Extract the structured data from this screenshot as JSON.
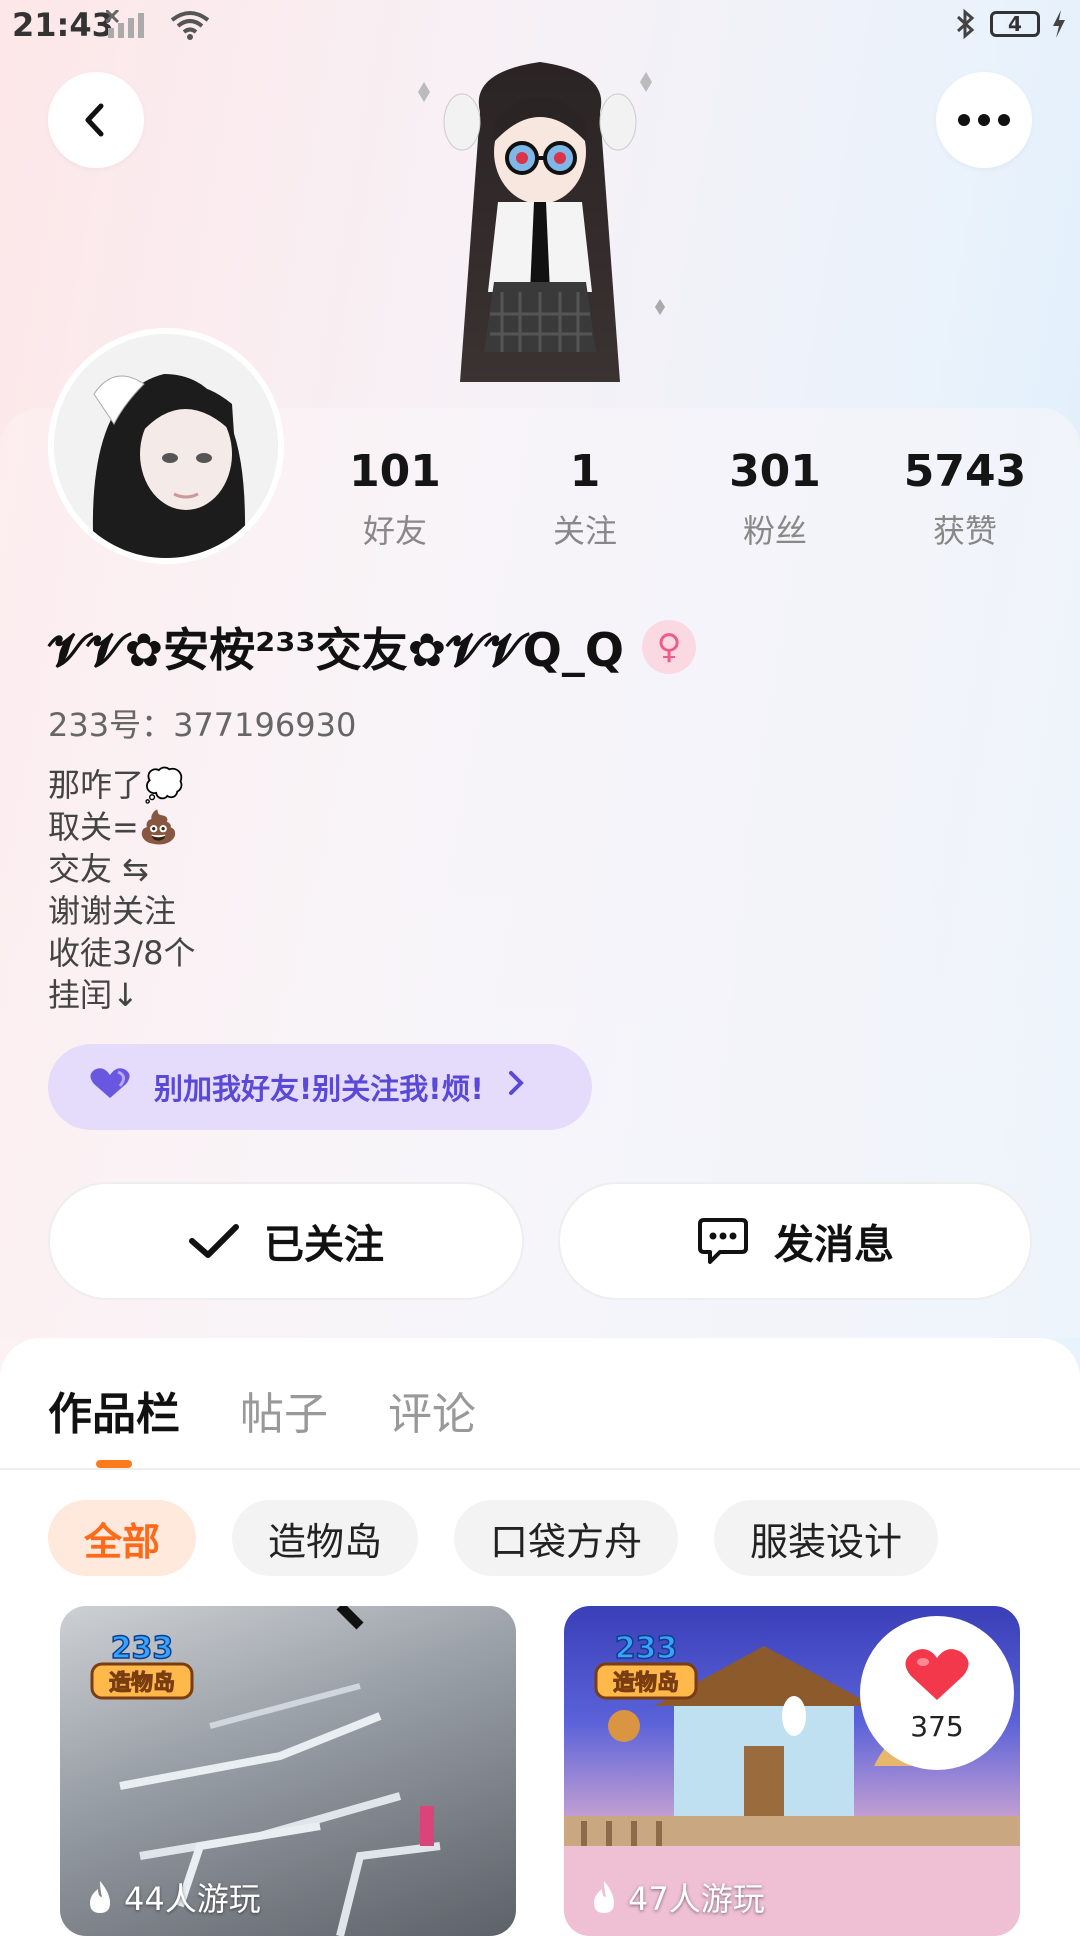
{
  "status_bar": {
    "time": "21:43",
    "battery": "4",
    "icons": [
      "sim-off-icon",
      "signal-icon",
      "wifi-icon",
      "bluetooth-icon",
      "battery-icon",
      "charging-icon"
    ]
  },
  "header": {
    "back_icon": "chevron-left-icon",
    "more_icon": "more-dots-icon"
  },
  "profile": {
    "nickname": "𝓥𝓥✿安桉²³³交友✿𝓥𝓥Q_Q",
    "gender_symbol": "♀",
    "uid": "233号：377196930",
    "bio": [
      "那咋了💭",
      "取关=💩",
      "交友 ⇆",
      "谢谢关注",
      "收徒3/8个",
      "挂闰↓"
    ],
    "notice": "别加我好友!别关注我!烦!"
  },
  "stats": [
    {
      "value": "101",
      "label": "好友"
    },
    {
      "value": "1",
      "label": "关注"
    },
    {
      "value": "301",
      "label": "粉丝"
    },
    {
      "value": "5743",
      "label": "获赞"
    }
  ],
  "actions": {
    "followed_label": "已关注",
    "message_label": "发消息"
  },
  "tabs": [
    "作品栏",
    "帖子",
    "评论"
  ],
  "active_tab": 0,
  "chips": [
    "全部",
    "造物岛",
    "口袋方舟",
    "服装设计"
  ],
  "works": [
    {
      "logo_text": "233",
      "logo_sub": "造物岛",
      "plays": "44人游玩"
    },
    {
      "logo_text": "233",
      "logo_sub": "造物岛",
      "plays": "47人游玩",
      "likes": "375"
    }
  ],
  "colors": {
    "accent": "#ff7a1a",
    "notice_bg": "#e4dcfa",
    "notice_text": "#5a48d6",
    "like_red": "#f2384a"
  }
}
